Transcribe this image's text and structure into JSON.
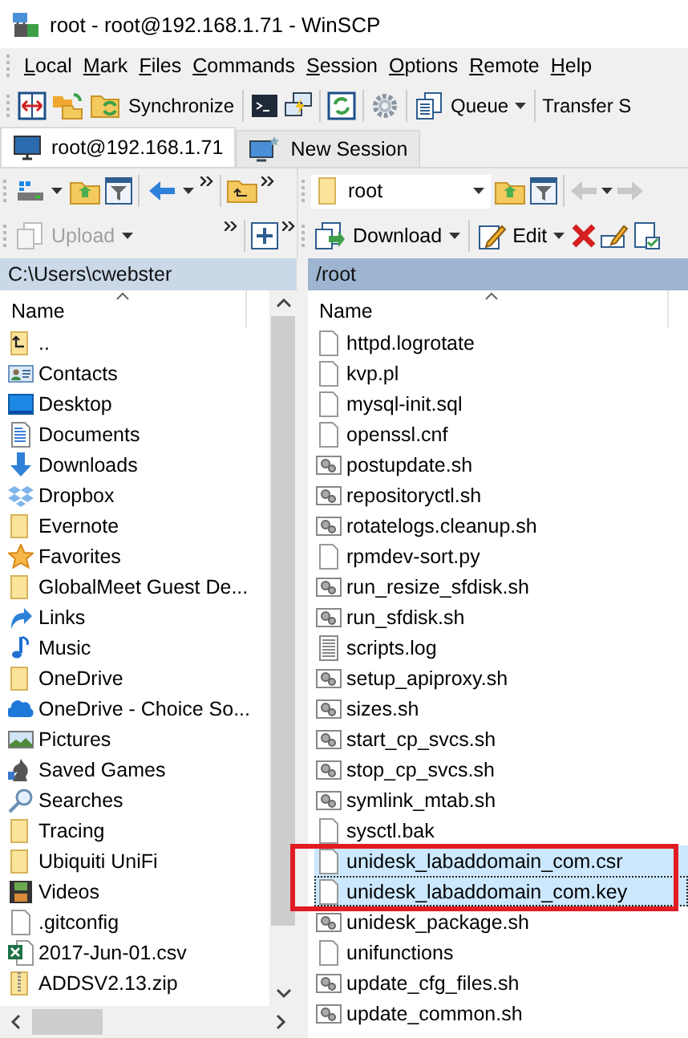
{
  "window": {
    "title": "root - root@192.168.1.71 - WinSCP"
  },
  "menu": [
    {
      "label": "Local"
    },
    {
      "label": "Mark"
    },
    {
      "label": "Files"
    },
    {
      "label": "Commands"
    },
    {
      "label": "Session"
    },
    {
      "label": "Options"
    },
    {
      "label": "Remote"
    },
    {
      "label": "Help"
    }
  ],
  "toolbar": {
    "synchronize": "Synchronize",
    "queue": "Queue",
    "transfer_settings": "Transfer S"
  },
  "tabs": [
    {
      "label": "root@192.168.1.71",
      "kind": "session",
      "selected": true
    },
    {
      "label": "New Session",
      "kind": "new",
      "selected": false
    }
  ],
  "local": {
    "active": false,
    "upload": {
      "label": "Upload",
      "disabled": true
    },
    "path": "C:\\Users\\cwebster",
    "column": "Name",
    "items": [
      {
        "name": "..",
        "kind": "parent"
      },
      {
        "name": "Contacts",
        "kind": "contacts"
      },
      {
        "name": "Desktop",
        "kind": "desktop"
      },
      {
        "name": "Documents",
        "kind": "documents"
      },
      {
        "name": "Downloads",
        "kind": "downloads"
      },
      {
        "name": "Dropbox",
        "kind": "dropbox"
      },
      {
        "name": "Evernote",
        "kind": "folder"
      },
      {
        "name": "Favorites",
        "kind": "favorites"
      },
      {
        "name": "GlobalMeet Guest De...",
        "kind": "folder"
      },
      {
        "name": "Links",
        "kind": "links"
      },
      {
        "name": "Music",
        "kind": "music"
      },
      {
        "name": "OneDrive",
        "kind": "folder"
      },
      {
        "name": "OneDrive - Choice So...",
        "kind": "onedrive"
      },
      {
        "name": "Pictures",
        "kind": "pictures"
      },
      {
        "name": "Saved Games",
        "kind": "games"
      },
      {
        "name": "Searches",
        "kind": "search"
      },
      {
        "name": "Tracing",
        "kind": "folder"
      },
      {
        "name": "Ubiquiti UniFi",
        "kind": "folder"
      },
      {
        "name": "Videos",
        "kind": "videos"
      },
      {
        "name": ".gitconfig",
        "kind": "file"
      },
      {
        "name": "2017-Jun-01.csv",
        "kind": "spreadsheet"
      },
      {
        "name": "ADDSV2.13.zip",
        "kind": "zip"
      }
    ]
  },
  "remote": {
    "active": true,
    "path_box": "root",
    "download": "Download",
    "edit": "Edit",
    "path": "/root",
    "column": "Name",
    "items": [
      {
        "name": "httpd.logrotate",
        "kind": "file",
        "selected": false,
        "focused": false
      },
      {
        "name": "kvp.pl",
        "kind": "file",
        "selected": false,
        "focused": false
      },
      {
        "name": "mysql-init.sql",
        "kind": "file",
        "selected": false,
        "focused": false
      },
      {
        "name": "openssl.cnf",
        "kind": "file",
        "selected": false,
        "focused": false
      },
      {
        "name": "postupdate.sh",
        "kind": "script",
        "selected": false,
        "focused": false
      },
      {
        "name": "repositoryctl.sh",
        "kind": "script",
        "selected": false,
        "focused": false
      },
      {
        "name": "rotatelogs.cleanup.sh",
        "kind": "script",
        "selected": false,
        "focused": false
      },
      {
        "name": "rpmdev-sort.py",
        "kind": "file",
        "selected": false,
        "focused": false
      },
      {
        "name": "run_resize_sfdisk.sh",
        "kind": "script",
        "selected": false,
        "focused": false
      },
      {
        "name": "run_sfdisk.sh",
        "kind": "script",
        "selected": false,
        "focused": false
      },
      {
        "name": "scripts.log",
        "kind": "text",
        "selected": false,
        "focused": false
      },
      {
        "name": "setup_apiproxy.sh",
        "kind": "script",
        "selected": false,
        "focused": false
      },
      {
        "name": "sizes.sh",
        "kind": "script",
        "selected": false,
        "focused": false
      },
      {
        "name": "start_cp_svcs.sh",
        "kind": "script",
        "selected": false,
        "focused": false
      },
      {
        "name": "stop_cp_svcs.sh",
        "kind": "script",
        "selected": false,
        "focused": false
      },
      {
        "name": "symlink_mtab.sh",
        "kind": "script",
        "selected": false,
        "focused": false
      },
      {
        "name": "sysctl.bak",
        "kind": "file",
        "selected": false,
        "focused": false
      },
      {
        "name": "unidesk_labaddomain_com.csr",
        "kind": "file",
        "selected": true,
        "focused": false
      },
      {
        "name": "unidesk_labaddomain_com.key",
        "kind": "file",
        "selected": true,
        "focused": true
      },
      {
        "name": "unidesk_package.sh",
        "kind": "script",
        "selected": false,
        "focused": false
      },
      {
        "name": "unifunctions",
        "kind": "file",
        "selected": false,
        "focused": false
      },
      {
        "name": "update_cfg_files.sh",
        "kind": "script",
        "selected": false,
        "focused": false
      },
      {
        "name": "update_common.sh",
        "kind": "script",
        "selected": false,
        "focused": false
      }
    ]
  }
}
